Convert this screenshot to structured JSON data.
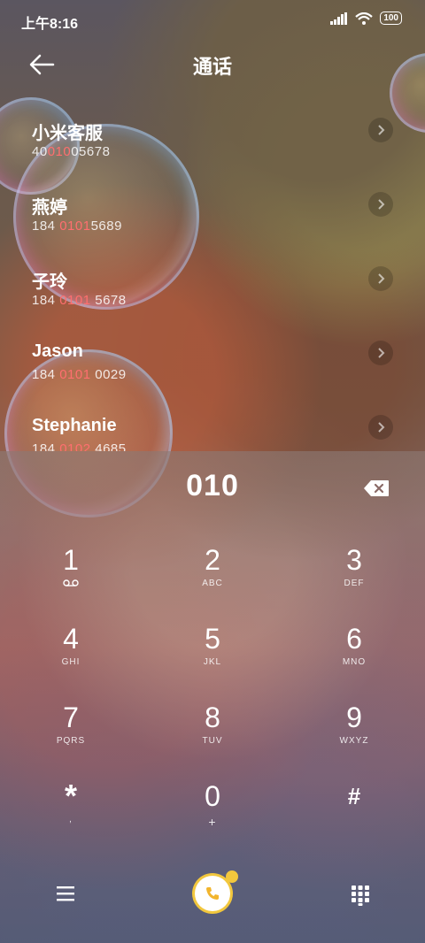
{
  "status": {
    "time": "上午8:16",
    "battery": "100"
  },
  "header": {
    "title": "通话"
  },
  "contacts": [
    {
      "name": "小米客服",
      "number_pre": "40",
      "number_hl": "010",
      "number_post": "05678"
    },
    {
      "name": "燕婷",
      "number_pre": "184 ",
      "number_hl": "0101",
      "number_post": "5689"
    },
    {
      "name": "子玲",
      "number_pre": "184 ",
      "number_hl": "0101",
      "number_post": " 5678"
    },
    {
      "name": "Jason",
      "number_pre": "184 ",
      "number_hl": "0101",
      "number_post": " 0029"
    },
    {
      "name": "Stephanie",
      "number_pre": "184 ",
      "number_hl": "0102",
      "number_post": " 4685"
    }
  ],
  "dialer": {
    "entry": "010",
    "keys": [
      {
        "digit": "1",
        "letters": ""
      },
      {
        "digit": "2",
        "letters": "ABC"
      },
      {
        "digit": "3",
        "letters": "DEF"
      },
      {
        "digit": "4",
        "letters": "GHI"
      },
      {
        "digit": "5",
        "letters": "JKL"
      },
      {
        "digit": "6",
        "letters": "MNO"
      },
      {
        "digit": "7",
        "letters": "PQRS"
      },
      {
        "digit": "8",
        "letters": "TUV"
      },
      {
        "digit": "9",
        "letters": "WXYZ"
      },
      {
        "digit": "*",
        "letters": ","
      },
      {
        "digit": "0",
        "letters": "+"
      },
      {
        "digit": "#",
        "letters": ""
      }
    ]
  },
  "colors": {
    "highlight": "#ff6f6f",
    "call_ring": "#f2c73d"
  },
  "icons": [
    "back-arrow-icon",
    "backspace-icon",
    "voicemail-icon",
    "menu-icon",
    "phone-icon",
    "keypad-icon",
    "chevron-right-icon"
  ]
}
